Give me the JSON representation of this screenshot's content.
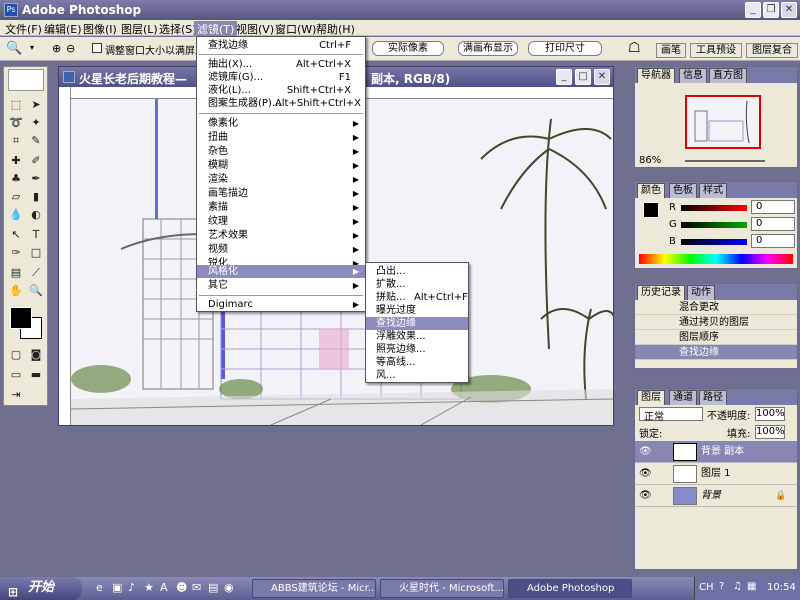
{
  "app": {
    "title": "Adobe Photoshop"
  },
  "menubar": {
    "items": [
      "文件(F)",
      "编辑(E)",
      "图像(I)",
      "图层(L)",
      "选择(S)",
      "滤镜(T)",
      "视图(V)",
      "窗口(W)",
      "帮助(H)"
    ],
    "active_index": 5
  },
  "options_bar": {
    "checkbox_label": "调整窗口大小以满屏显",
    "buttons": [
      "实际像素",
      "满画布显示",
      "打印尺寸"
    ],
    "palette_tabs": [
      "画笔",
      "工具预设",
      "图层复合"
    ]
  },
  "document": {
    "title": "火星长老后期教程—",
    "title_suffix": "副本, RGB/8)"
  },
  "filter_menu": {
    "items": [
      {
        "label": "查找边缘",
        "shortcut": "Ctrl+F"
      },
      {
        "label": "抽出(X)...",
        "shortcut": "Alt+Ctrl+X"
      },
      {
        "label": "滤镜库(G)...",
        "shortcut": "F1"
      },
      {
        "label": "液化(L)...",
        "shortcut": "Shift+Ctrl+X"
      },
      {
        "label": "图案生成器(P)...",
        "shortcut": "Alt+Shift+Ctrl+X"
      },
      {
        "label": "像素化"
      },
      {
        "label": "扭曲"
      },
      {
        "label": "杂色"
      },
      {
        "label": "模糊"
      },
      {
        "label": "渲染"
      },
      {
        "label": "画笔描边"
      },
      {
        "label": "素描"
      },
      {
        "label": "纹理"
      },
      {
        "label": "艺术效果"
      },
      {
        "label": "视频"
      },
      {
        "label": "锐化"
      },
      {
        "label": "风格化"
      },
      {
        "label": "其它"
      },
      {
        "label": "Digimarc"
      }
    ],
    "highlighted": "风格化"
  },
  "stylize_menu": {
    "items": [
      {
        "label": "凸出..."
      },
      {
        "label": "扩散..."
      },
      {
        "label": "拼贴...",
        "shortcut": "Alt+Ctrl+F"
      },
      {
        "label": "曝光过度"
      },
      {
        "label": "查找边缘"
      },
      {
        "label": "浮雕效果..."
      },
      {
        "label": "照亮边缘..."
      },
      {
        "label": "等高线..."
      },
      {
        "label": "风..."
      }
    ],
    "highlighted": "查找边缘"
  },
  "navigator": {
    "tabs": [
      "导航器",
      "信息",
      "直方图"
    ],
    "zoom": "86%"
  },
  "color_palette": {
    "tabs": [
      "颜色",
      "色板",
      "样式"
    ],
    "channels": [
      {
        "name": "R",
        "value": "0"
      },
      {
        "name": "G",
        "value": "0"
      },
      {
        "name": "B",
        "value": "0"
      }
    ]
  },
  "history": {
    "tabs": [
      "历史记录",
      "动作"
    ],
    "items": [
      "混合更改",
      "通过拷贝的图层",
      "图层顺序",
      "查找边缘"
    ],
    "selected_index": 3
  },
  "layers": {
    "tabs": [
      "图层",
      "通道",
      "路径"
    ],
    "blend_mode": "正常",
    "opacity_label": "不透明度:",
    "opacity": "100%",
    "lock_label": "锁定:",
    "fill_label": "填充:",
    "fill": "100%",
    "items": [
      "背景 副本",
      "图层 1",
      "背景"
    ],
    "selected_index": 0
  },
  "taskbar": {
    "start_label": "开始",
    "tasks": [
      "ABBS建筑论坛 - Micr...",
      "火星时代 - Microsoft...",
      "Adobe Photoshop"
    ],
    "active_task_index": 2,
    "tray_lang": "CH",
    "clock": "10:54"
  }
}
